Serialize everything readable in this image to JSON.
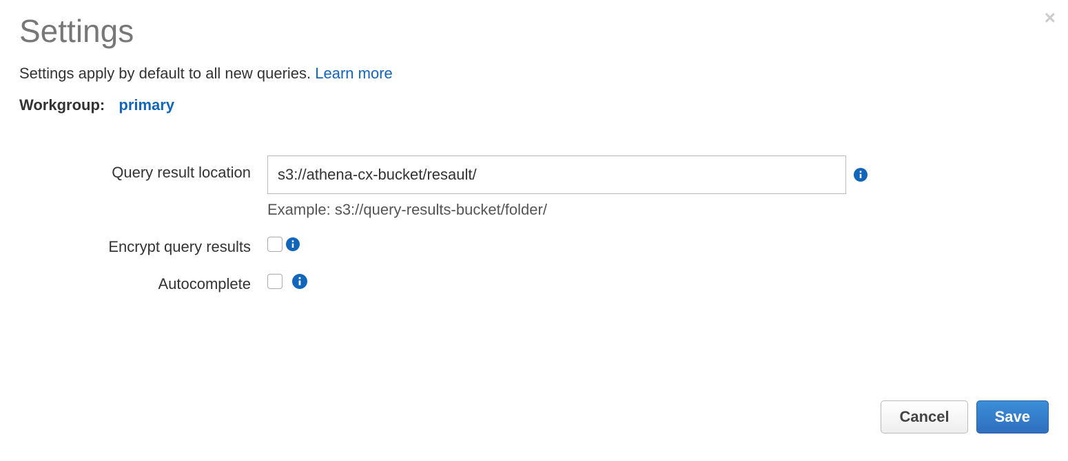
{
  "title": "Settings",
  "subtitle_text": "Settings apply by default to all new queries. ",
  "learn_more": "Learn more",
  "workgroup": {
    "label": "Workgroup:",
    "value": "primary"
  },
  "form": {
    "query_location": {
      "label": "Query result location",
      "value": "s3://athena-cx-bucket/resault/",
      "hint": "Example: s3://query-results-bucket/folder/"
    },
    "encrypt": {
      "label": "Encrypt query results",
      "checked": false
    },
    "autocomplete": {
      "label": "Autocomplete",
      "checked": false
    }
  },
  "buttons": {
    "cancel": "Cancel",
    "save": "Save"
  }
}
